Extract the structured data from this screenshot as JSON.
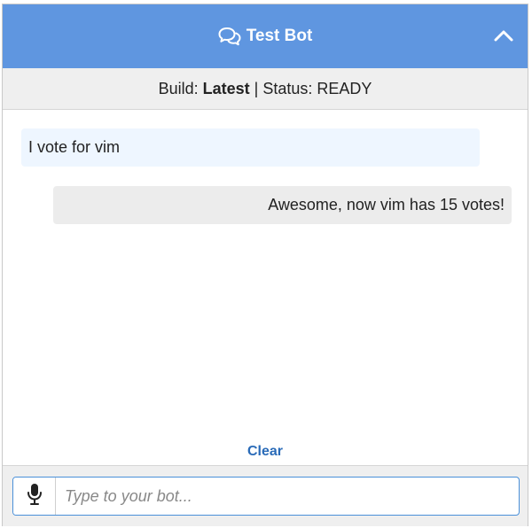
{
  "header": {
    "title": "Test Bot",
    "chat_icon": "chat-bubbles-icon",
    "collapse_icon": "chevron-up-icon",
    "background": "#5f96e0"
  },
  "status": {
    "build_prefix": "Build: ",
    "build_value": "Latest",
    "separator": " | ",
    "status_text": "Status: READY"
  },
  "messages": [
    {
      "from": "user",
      "text": "I vote for vim"
    },
    {
      "from": "bot",
      "text": "Awesome, now vim has 15 votes!"
    }
  ],
  "clear_label": "Clear",
  "input": {
    "mic_icon": "microphone-icon",
    "placeholder": "Type to your bot...",
    "value": ""
  }
}
